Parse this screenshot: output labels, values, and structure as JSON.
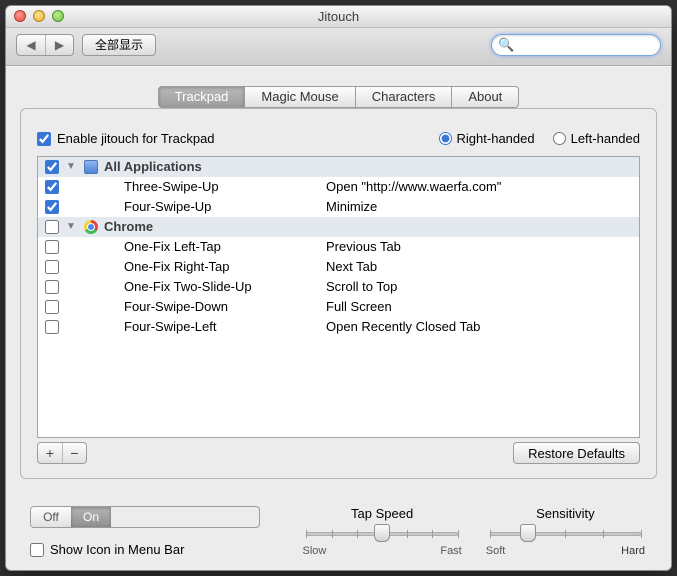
{
  "window": {
    "title": "Jitouch"
  },
  "toolbar": {
    "show_all": "全部显示",
    "search_placeholder": ""
  },
  "tabs": {
    "trackpad": "Trackpad",
    "mouse": "Magic Mouse",
    "characters": "Characters",
    "about": "About"
  },
  "settings": {
    "enable_label": "Enable jitouch for Trackpad",
    "right_label": "Right-handed",
    "left_label": "Left-handed"
  },
  "groups": {
    "all": "All Applications",
    "chrome": "Chrome"
  },
  "rows": {
    "r1g": "Three-Swipe-Up",
    "r1a": "Open \"http://www.waerfa.com\"",
    "r2g": "Four-Swipe-Up",
    "r2a": "Minimize",
    "r3g": "One-Fix Left-Tap",
    "r3a": "Previous Tab",
    "r4g": "One-Fix Right-Tap",
    "r4a": "Next Tab",
    "r5g": "One-Fix Two-Slide-Up",
    "r5a": "Scroll to Top",
    "r6g": "Four-Swipe-Down",
    "r6a": "Full Screen",
    "r7g": "Four-Swipe-Left",
    "r7a": "Open Recently Closed Tab"
  },
  "buttons": {
    "restore": "Restore Defaults",
    "off": "Off",
    "on": "On"
  },
  "menubar": {
    "label": "Show Icon in Menu Bar"
  },
  "sliders": {
    "tap": {
      "title": "Tap Speed",
      "min": "Slow",
      "max": "Fast",
      "value": 0.5
    },
    "sens": {
      "title": "Sensitivity",
      "min": "Soft",
      "max": "Hard",
      "value": 0.25
    }
  }
}
